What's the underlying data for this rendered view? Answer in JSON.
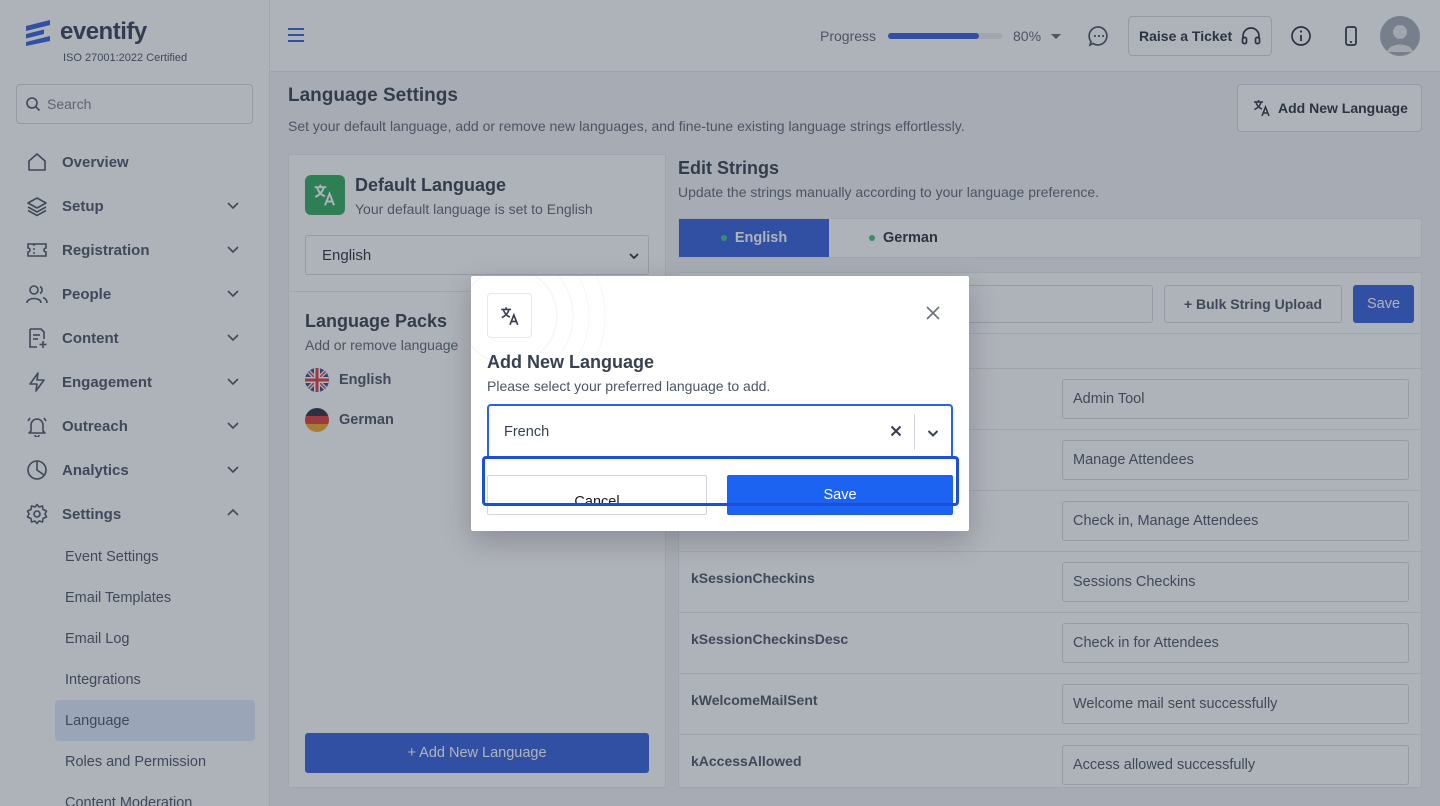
{
  "brand": {
    "name": "eventify",
    "certification": "ISO 27001:2022 Certified"
  },
  "search": {
    "placeholder": "Search"
  },
  "sidebar": {
    "items": [
      {
        "label": "Overview"
      },
      {
        "label": "Setup"
      },
      {
        "label": "Registration"
      },
      {
        "label": "People"
      },
      {
        "label": "Content"
      },
      {
        "label": "Engagement"
      },
      {
        "label": "Outreach"
      },
      {
        "label": "Analytics"
      },
      {
        "label": "Settings"
      }
    ],
    "settings_sub": [
      {
        "label": "Event Settings"
      },
      {
        "label": "Email Templates"
      },
      {
        "label": "Email Log"
      },
      {
        "label": "Integrations"
      },
      {
        "label": "Language"
      },
      {
        "label": "Roles and Permission"
      },
      {
        "label": "Content Moderation"
      }
    ]
  },
  "header": {
    "progress_label": "Progress",
    "progress_value": 80,
    "progress_text": "80%",
    "ticket_label": "Raise a Ticket"
  },
  "page": {
    "title": "Language Settings",
    "subtitle": "Set your default language, add or remove new languages, and fine-tune existing language strings effortlessly.",
    "add_language_label": "Add New Language"
  },
  "default_language": {
    "title": "Default Language",
    "subtitle": "Your default language is set to English",
    "selected": "English"
  },
  "language_packs": {
    "title": "Language Packs",
    "subtitle": "Add or remove language",
    "items": [
      {
        "label": "English"
      },
      {
        "label": "German"
      }
    ],
    "add_label": "+ Add New Language"
  },
  "edit_strings": {
    "title": "Edit Strings",
    "subtitle": "Update the strings manually according to your language preference.",
    "tabs": [
      {
        "label": "English"
      },
      {
        "label": "German"
      }
    ],
    "bulk_upload_label": "+ Bulk String Upload",
    "save_label": "Save",
    "rows": [
      {
        "key": "",
        "value": "Admin Tool"
      },
      {
        "key": "",
        "value": "Manage Attendees"
      },
      {
        "key": "",
        "value": "Check in, Manage Attendees"
      },
      {
        "key": "kSessionCheckins",
        "value": "Sessions Checkins"
      },
      {
        "key": "kSessionCheckinsDesc",
        "value": "Check in for Attendees"
      },
      {
        "key": "kWelcomeMailSent",
        "value": "Welcome mail sent successfully"
      },
      {
        "key": "kAccessAllowed",
        "value": "Access allowed successfully"
      }
    ]
  },
  "modal": {
    "title": "Add New Language",
    "subtitle": "Please select your preferred language to add.",
    "selected_language": "French",
    "cancel_label": "Cancel",
    "save_label": "Save"
  },
  "colors": {
    "primary": "#1d4ed8",
    "success": "#16a34a",
    "modal_save": "#1d63f2"
  }
}
